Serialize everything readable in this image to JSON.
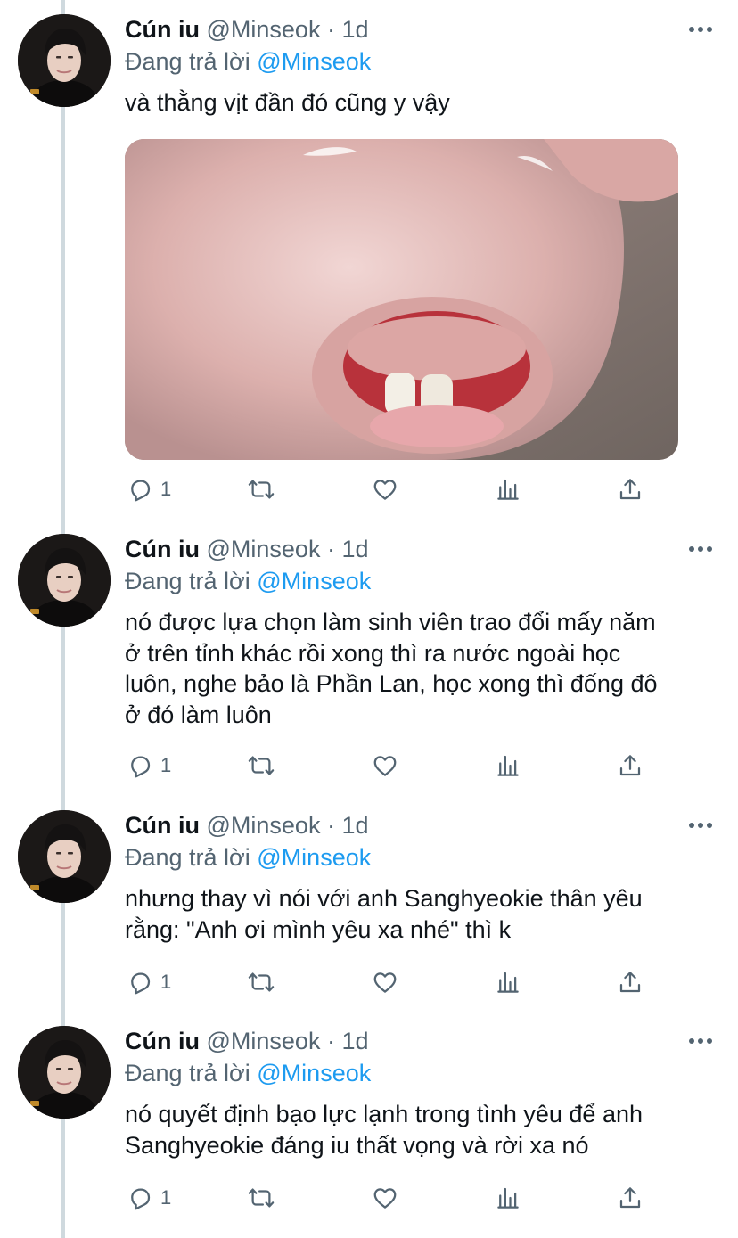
{
  "tweets": [
    {
      "name": "Cún iu",
      "handle": "@Minseok",
      "sep": "·",
      "time": "1d",
      "reply_prefix": "Đang trả lời",
      "reply_mention": "@Minseok",
      "text": "và thằng vịt đần đó cũng y vậy",
      "has_media": true,
      "reply_count": "1"
    },
    {
      "name": "Cún iu",
      "handle": "@Minseok",
      "sep": "·",
      "time": "1d",
      "reply_prefix": "Đang trả lời",
      "reply_mention": "@Minseok",
      "text_lines": [
        "nó được lựa chọn làm sinh viên trao đổi mấy năm",
        "ở trên tỉnh khác rồi xong thì ra nước ngoài học",
        "luôn, nghe bảo là Phần Lan, học xong thì đống đô",
        "ở đó làm luôn"
      ],
      "reply_count": "1"
    },
    {
      "name": "Cún iu",
      "handle": "@Minseok",
      "sep": "·",
      "time": "1d",
      "reply_prefix": "Đang trả lời",
      "reply_mention": "@Minseok",
      "text_lines": [
        "nhưng thay vì nói với anh Sanghyeokie thân yêu",
        "rằng: \"Anh ơi mình yêu xa nhé\" thì k"
      ],
      "reply_count": "1"
    },
    {
      "name": "Cún iu",
      "handle": "@Minseok",
      "sep": "·",
      "time": "1d",
      "reply_prefix": "Đang trả lời",
      "reply_mention": "@Minseok",
      "text_lines": [
        "nó quyết định bạo lực lạnh trong tình yêu để anh",
        "Sanghyeokie đáng iu thất vọng và rời xa nó"
      ],
      "reply_count": "1"
    }
  ],
  "icons": {
    "reply": "reply-icon",
    "retweet": "retweet-icon",
    "like": "heart-icon",
    "views": "analytics-icon",
    "share": "share-icon",
    "more": "more-icon"
  },
  "colors": {
    "text": "#0f1419",
    "secondary": "#536471",
    "accent": "#1d9bf0",
    "thread_line": "#cfd9de"
  }
}
